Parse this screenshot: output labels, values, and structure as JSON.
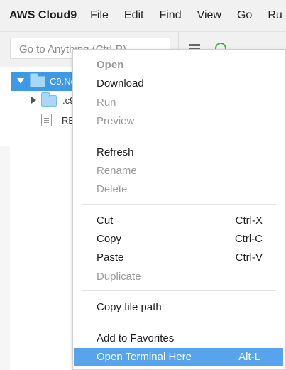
{
  "menubar": {
    "brand": "AWS Cloud9",
    "items": [
      "File",
      "Edit",
      "Find",
      "View",
      "Go",
      "Ru"
    ]
  },
  "toolbar": {
    "search_placeholder": "Go to Anything (Ctrl-P)"
  },
  "tree": {
    "root_label": "C9.No",
    "c9_label": ".c9",
    "readme_label": "RE"
  },
  "context_menu": {
    "items": [
      {
        "label": "Open",
        "state": "disabled-bold"
      },
      {
        "label": "Download",
        "state": "enabled"
      },
      {
        "label": "Run",
        "state": "disabled"
      },
      {
        "label": "Preview",
        "state": "disabled"
      },
      {
        "label": "Refresh",
        "state": "enabled"
      },
      {
        "label": "Rename",
        "state": "disabled"
      },
      {
        "label": "Delete",
        "state": "disabled"
      },
      {
        "label": "Cut",
        "shortcut": "Ctrl-X",
        "state": "enabled"
      },
      {
        "label": "Copy",
        "shortcut": "Ctrl-C",
        "state": "enabled"
      },
      {
        "label": "Paste",
        "shortcut": "Ctrl-V",
        "state": "enabled"
      },
      {
        "label": "Duplicate",
        "state": "disabled"
      },
      {
        "label": "Copy file path",
        "state": "enabled"
      },
      {
        "label": "Add to Favorites",
        "state": "enabled"
      },
      {
        "label": "Open Terminal Here",
        "shortcut": "Alt-L",
        "state": "highlighted"
      }
    ]
  },
  "colors": {
    "selection": "#3f9ae6",
    "highlight": "#58a4ec",
    "disabled_text": "#9a9a9a"
  }
}
